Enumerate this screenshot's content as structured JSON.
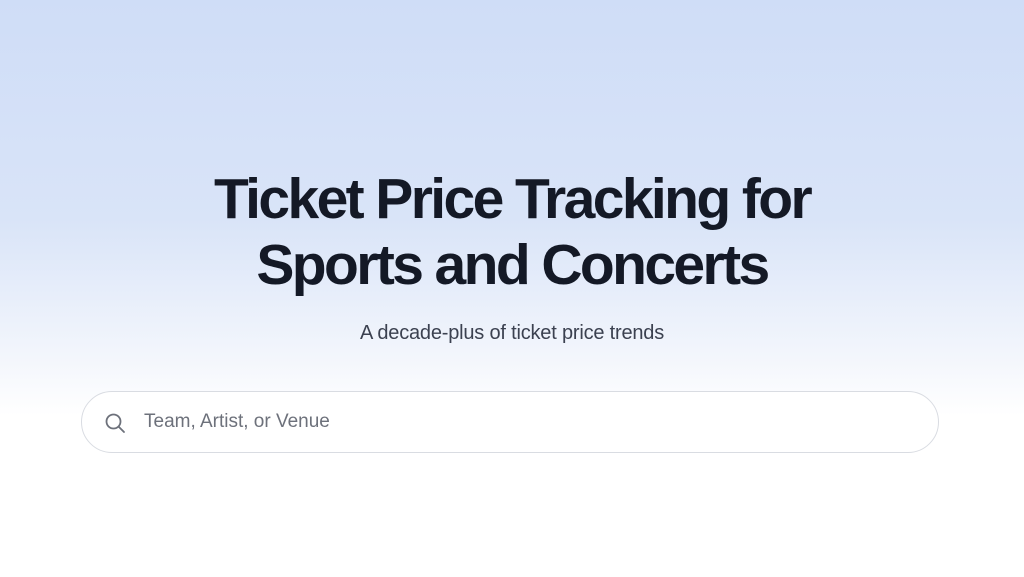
{
  "hero": {
    "title_line1": "Ticket Price Tracking for",
    "title_line2": "Sports and Concerts",
    "subtitle": "A decade-plus of ticket price trends"
  },
  "search": {
    "placeholder": "Team, Artist, or Venue",
    "value": "",
    "icon": "search-icon"
  },
  "colors": {
    "background_top": "#cfddf7",
    "background_bottom": "#ffffff",
    "title": "#141926",
    "subtitle": "#3b4150",
    "placeholder": "#6d717b",
    "search_border": "#d9dce2"
  }
}
